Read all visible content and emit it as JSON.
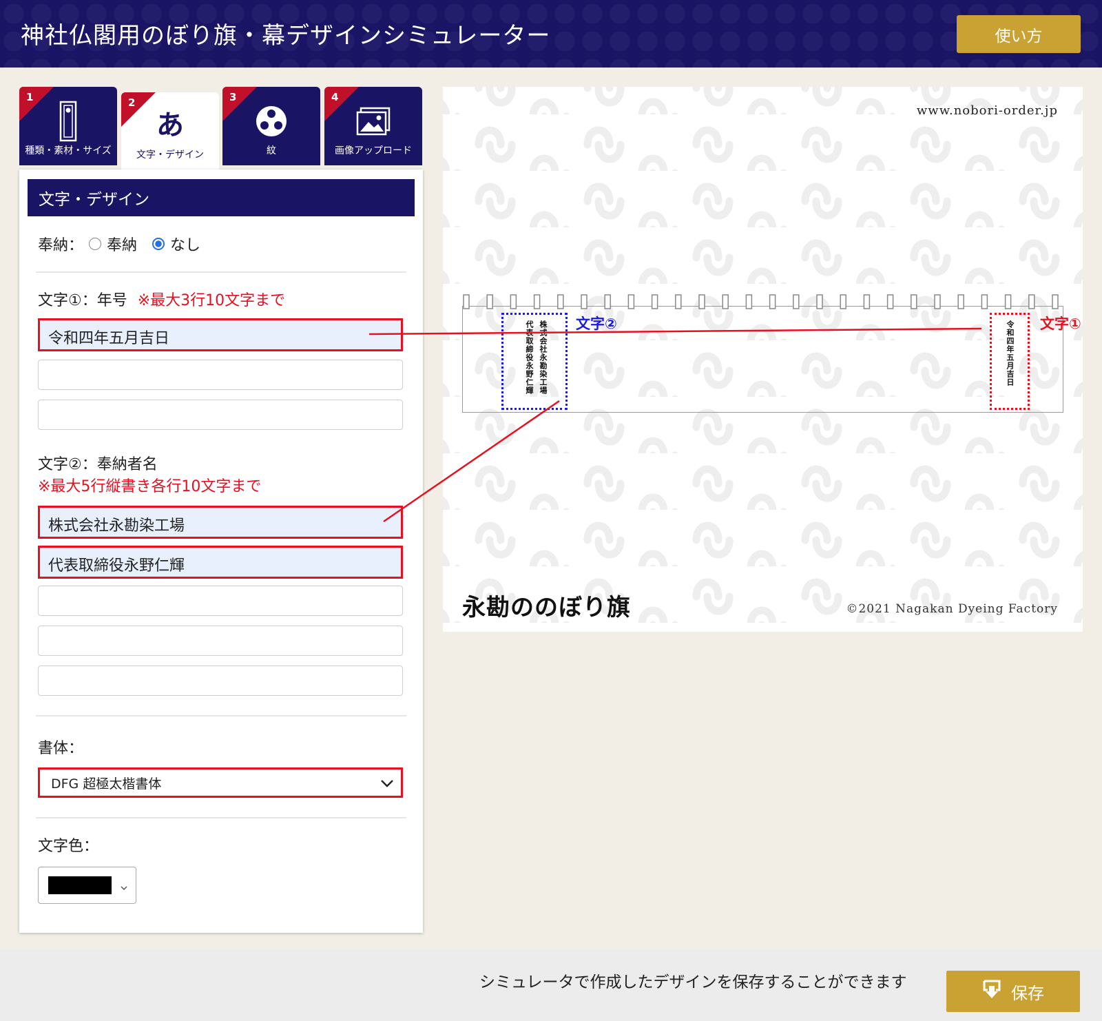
{
  "header": {
    "title": "神社仏閣用のぼり旗・幕デザインシミュレーター",
    "help_label": "使い方"
  },
  "tabs": [
    {
      "num": "1",
      "label": "種類・素材・サイズ",
      "icon": "banner-icon"
    },
    {
      "num": "2",
      "label": "文字・デザイン",
      "icon": "hiragana-a-icon",
      "glyph": "あ"
    },
    {
      "num": "3",
      "label": "紋",
      "icon": "tomoe-crest-icon"
    },
    {
      "num": "4",
      "label": "画像アップロード",
      "icon": "image-icon"
    }
  ],
  "panel": {
    "title": "文字・デザイン",
    "hounou": {
      "label": "奉納：",
      "options": [
        "奉納",
        "なし"
      ],
      "selected": "なし"
    },
    "text1": {
      "label": "文字①：年号",
      "note": "※最大3行10文字まで",
      "values": [
        "令和四年五月吉日",
        "",
        ""
      ]
    },
    "text2": {
      "label": "文字②：奉納者名",
      "note": "※最大5行縦書き各行10文字まで",
      "values": [
        "株式会社永勘染工場",
        "代表取締役永野仁輝",
        "",
        "",
        ""
      ]
    },
    "font": {
      "label": "書体：",
      "value": "DFG 超極太楷書体"
    },
    "color": {
      "label": "文字色：",
      "value": "#000000"
    }
  },
  "preview": {
    "url": "www.nobori-order.jp",
    "logo": "永勘ののぼり旗",
    "copyright": "©2021 Nagakan Dyeing Factory",
    "marker1": "文字①",
    "marker2": "文字②",
    "colors": {
      "marker1": "#e8101e",
      "marker2": "#1a1ae8"
    }
  },
  "footer": {
    "message": "シミュレータで作成したデザインを保存することができます",
    "save_label": "保存"
  },
  "colors": {
    "navy": "#191464",
    "gold": "#c9a233",
    "red": "#e8101e"
  }
}
